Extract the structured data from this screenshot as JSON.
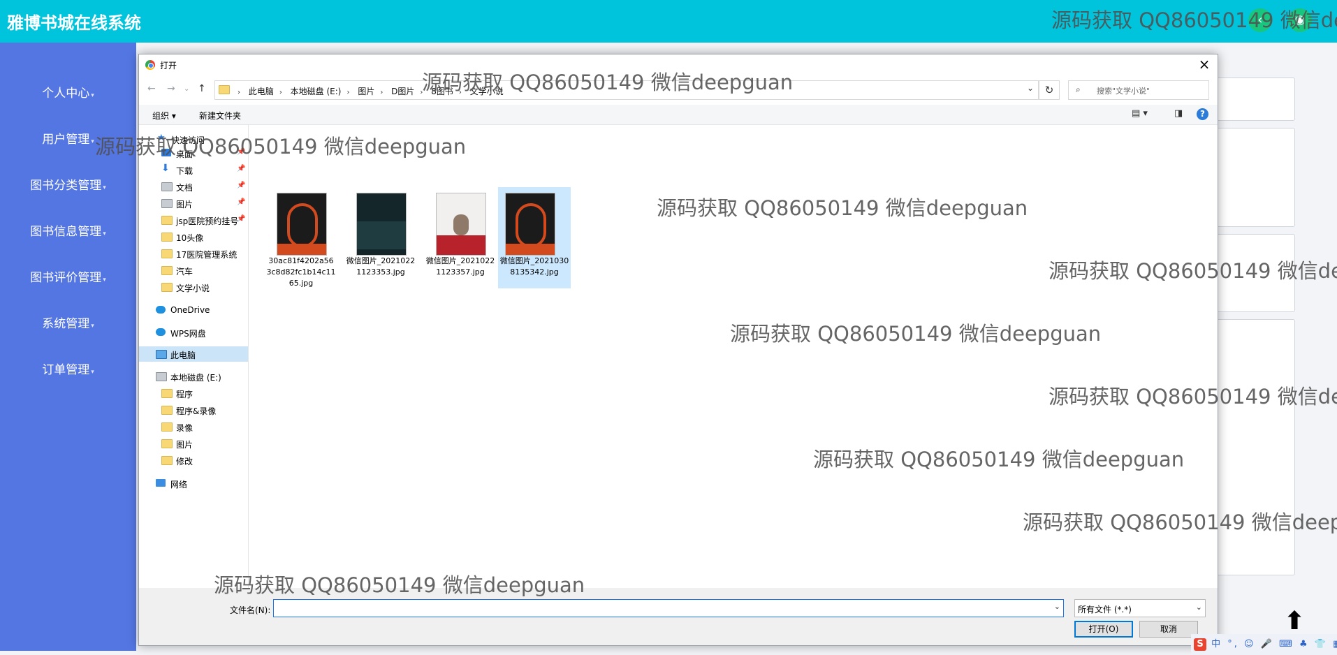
{
  "app": {
    "title": "雅博书城在线系统"
  },
  "sidebar": {
    "items": [
      {
        "label": "个人中心"
      },
      {
        "label": "用户管理"
      },
      {
        "label": "图书分类管理"
      },
      {
        "label": "图书信息管理"
      },
      {
        "label": "图书评价管理"
      },
      {
        "label": "系统管理"
      },
      {
        "label": "订单管理"
      }
    ]
  },
  "dialog": {
    "title": "打开",
    "close_glyph": "×",
    "breadcrumb": [
      "此电脑",
      "本地磁盘 (E:)",
      "图片",
      "D图片",
      "8图书",
      "文学小说"
    ],
    "search_placeholder": "搜索\"文学小说\"",
    "toolbar": {
      "organize": "组织 ▾",
      "new_folder": "新建文件夹"
    },
    "nav": {
      "quick_access": "快速访问",
      "items": [
        "桌面",
        "下载",
        "文档",
        "图片",
        "jsp医院预约挂号",
        "10头像",
        "17医院管理系统",
        "汽车",
        "文学小说"
      ],
      "onedrive": "OneDrive",
      "wps": "WPS网盘",
      "this_pc": "此电脑",
      "drive": "本地磁盘 (E:)",
      "drive_items": [
        "程序",
        "程序&录像",
        "录像",
        "图片",
        "修改"
      ],
      "network": "网络"
    },
    "files": [
      {
        "name": "30ac81f4202a563c8d82fc1b14c1165.jpg",
        "thumb_colors": [
          "#1b1b1b",
          "#d24a1e",
          "#2a2a2a"
        ]
      },
      {
        "name": "微信图片_20210221123353.jpg",
        "thumb_colors": [
          "#14262a",
          "#1f3d40",
          "#0d1a1c"
        ]
      },
      {
        "name": "微信图片_20210221123357.jpg",
        "thumb_colors": [
          "#f2f0ee",
          "#b8232b",
          "#e9e4de"
        ]
      },
      {
        "name": "微信图片_20210308135342.jpg",
        "thumb_colors": [
          "#1b1b1b",
          "#d24a1e",
          "#2a2a2a"
        ]
      }
    ],
    "filename_label": "文件名(N):",
    "filename_value": "",
    "filetype": "所有文件 (*.*)",
    "open_label": "打开(O)",
    "cancel_label": "取消"
  },
  "watermark": "源码获取 QQ86050149 微信deepguan",
  "tray": {
    "ime": "中",
    "glyphs": "°, ☺ 🎤 ⌨ ♣ 👕 ▦"
  }
}
